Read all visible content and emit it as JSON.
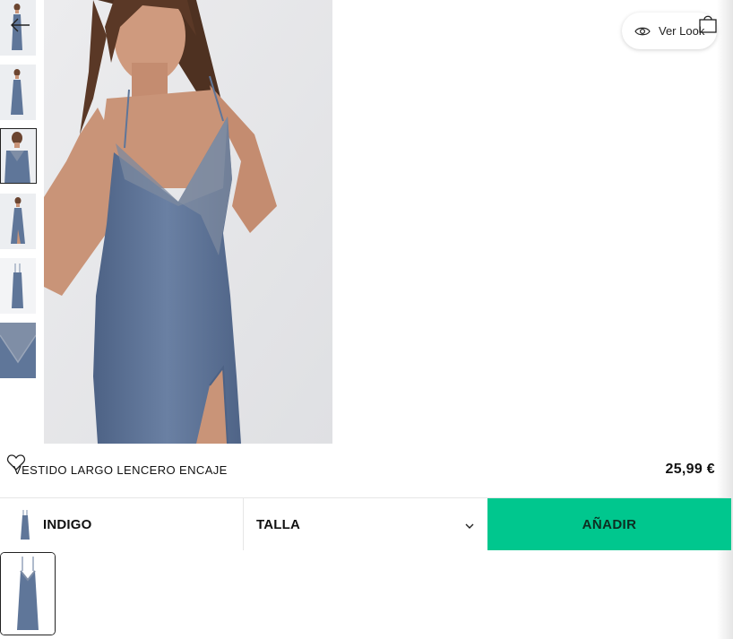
{
  "header": {
    "ver_look_label": "Ver Look"
  },
  "product": {
    "name": "VESTIDO LARGO LENCERO ENCAJE",
    "price": "25,99 €",
    "color": "INDIGO",
    "size_placeholder": "TALLA",
    "add_label": "AÑADIR"
  },
  "gallery": {
    "thumbnails": [
      "thumb-1",
      "thumb-2",
      "thumb-3",
      "thumb-4",
      "thumb-5",
      "thumb-6"
    ],
    "selected_index": 2
  },
  "colors": {
    "dress": "#5f7699",
    "dress_dark": "#4d6285",
    "skin": "#c99478",
    "hair": "#5a3826",
    "background": "#e9eaec",
    "accent": "#00c78e"
  },
  "icons": {
    "back": "arrow-left-icon",
    "view": "eye-icon",
    "bag": "shopping-bag-icon",
    "wishlist": "heart-icon",
    "dropdown": "chevron-down-icon"
  }
}
